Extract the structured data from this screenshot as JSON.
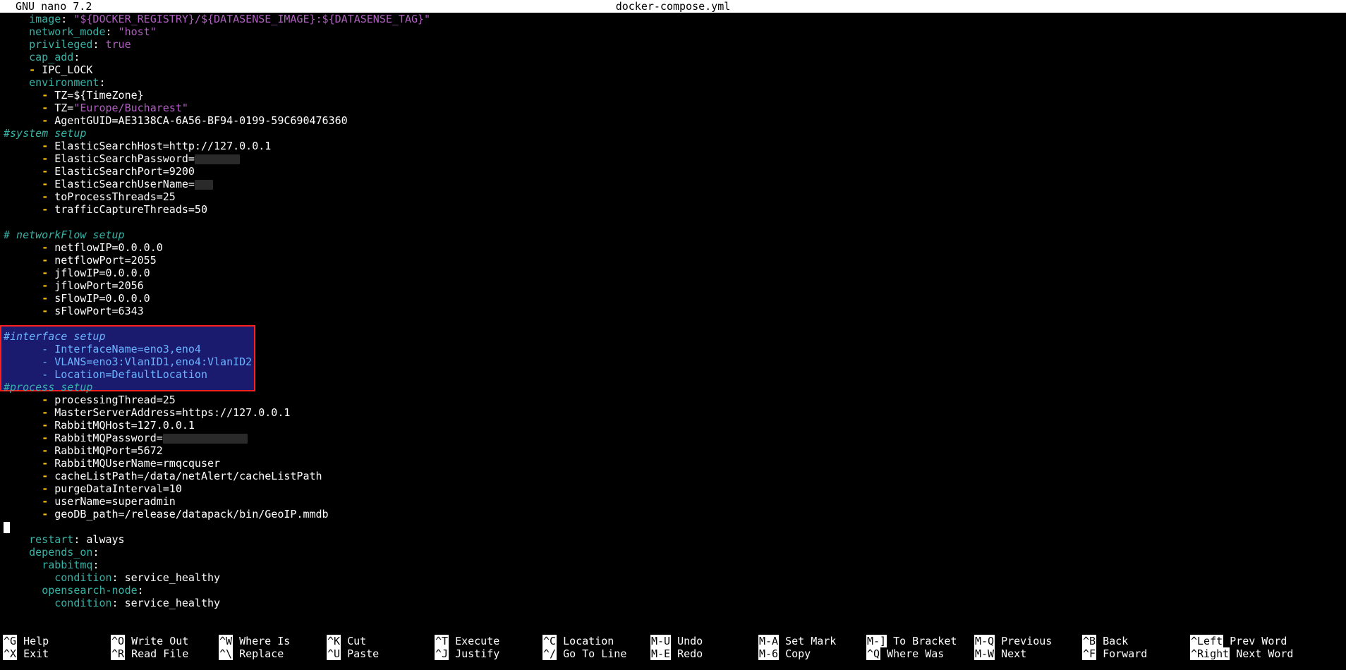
{
  "titlebar": {
    "version": "GNU nano 7.2",
    "filename": "docker-compose.yml"
  },
  "lines": {
    "l1": {
      "key": "image",
      "val": "\"${DOCKER_REGISTRY}/${DATASENSE_IMAGE}:${DATASENSE_TAG}\""
    },
    "l2": {
      "key": "network_mode",
      "val": "\"host\""
    },
    "l3": {
      "key": "privileged",
      "val": "true"
    },
    "l4": {
      "key": "cap_add"
    },
    "l5": {
      "item": "IPC_LOCK"
    },
    "l6": {
      "key": "environment"
    },
    "l7": {
      "item": "TZ=${TimeZone}"
    },
    "l8": {
      "item_prefix": "TZ=",
      "item_str": "\"Europe/Bucharest\""
    },
    "l9": {
      "item": "AgentGUID=AE3138CA-6A56-BF94-0199-59C690476360"
    },
    "c1": "#system setup",
    "l10": {
      "item": "ElasticSearchHost=http://127.0.0.1"
    },
    "l11": {
      "item": "ElasticSearchPassword="
    },
    "l12": {
      "item": "ElasticSearchPort=9200"
    },
    "l13": {
      "item": "ElasticSearchUserName="
    },
    "l14": {
      "item": "toProcessThreads=25"
    },
    "l15": {
      "item": "trafficCaptureThreads=50"
    },
    "c2": "# networkFlow setup",
    "l16": {
      "item": "netflowIP=0.0.0.0"
    },
    "l17": {
      "item": "netflowPort=2055"
    },
    "l18": {
      "item": "jflowIP=0.0.0.0"
    },
    "l19": {
      "item": "jflowPort=2056"
    },
    "l20": {
      "item": "sFlowIP=0.0.0.0"
    },
    "l21": {
      "item": "sFlowPort=6343"
    },
    "c3": "#interface setup",
    "l22": {
      "item": "InterfaceName=eno3,eno4"
    },
    "l23": {
      "item": "VLANS=eno3:VlanID1,eno4:VlanID2"
    },
    "l24": {
      "item": "Location=DefaultLocation"
    },
    "c4": "#process setup",
    "l25": {
      "item": "processingThread=25"
    },
    "l26": {
      "item": "MasterServerAddress=https://127.0.0.1"
    },
    "l27": {
      "item": "RabbitMQHost=127.0.0.1"
    },
    "l28": {
      "item": "RabbitMQPassword="
    },
    "l29": {
      "item": "RabbitMQPort=5672"
    },
    "l30": {
      "item": "RabbitMQUserName=rmqcquser"
    },
    "l31": {
      "item": "cacheListPath=/data/netAlert/cacheListPath"
    },
    "l32": {
      "item": "purgeDataInterval=10"
    },
    "l33": {
      "item": "userName=superadmin"
    },
    "l34": {
      "item": "geoDB_path=/release/datapack/bin/GeoIP.mmdb"
    },
    "l35": {
      "key": "restart",
      "val": "always"
    },
    "l36": {
      "key": "depends_on"
    },
    "l37": {
      "key": "rabbitmq"
    },
    "l38": {
      "key": "condition",
      "val": "service_healthy"
    },
    "l39": {
      "key": "opensearch-node"
    },
    "l40": {
      "key": "condition",
      "val": "service_healthy"
    }
  },
  "shortcuts": {
    "row1": [
      {
        "key": "^G",
        "label": "Help"
      },
      {
        "key": "^O",
        "label": "Write Out"
      },
      {
        "key": "^W",
        "label": "Where Is"
      },
      {
        "key": "^K",
        "label": "Cut"
      },
      {
        "key": "^T",
        "label": "Execute"
      },
      {
        "key": "^C",
        "label": "Location"
      },
      {
        "key": "M-U",
        "label": "Undo"
      },
      {
        "key": "M-A",
        "label": "Set Mark"
      },
      {
        "key": "M-]",
        "label": "To Bracket"
      },
      {
        "key": "M-Q",
        "label": "Previous"
      },
      {
        "key": "^B",
        "label": "Back"
      },
      {
        "key": "^Left",
        "label": "Prev Word"
      }
    ],
    "row2": [
      {
        "key": "^X",
        "label": "Exit"
      },
      {
        "key": "^R",
        "label": "Read File"
      },
      {
        "key": "^\\",
        "label": "Replace"
      },
      {
        "key": "^U",
        "label": "Paste"
      },
      {
        "key": "^J",
        "label": "Justify"
      },
      {
        "key": "^/",
        "label": "Go To Line"
      },
      {
        "key": "M-E",
        "label": "Redo"
      },
      {
        "key": "M-6",
        "label": "Copy"
      },
      {
        "key": "^Q",
        "label": "Where Was"
      },
      {
        "key": "M-W",
        "label": "Next"
      },
      {
        "key": "^F",
        "label": "Forward"
      },
      {
        "key": "^Right",
        "label": "Next Word"
      }
    ]
  },
  "colors": {
    "key": "#5fd7d7",
    "string": "#b060c0",
    "dash": "#ffc000",
    "comment": "#36b3a6",
    "selection": "#1a1a6e",
    "annotation_box": "#ff1f1f"
  }
}
